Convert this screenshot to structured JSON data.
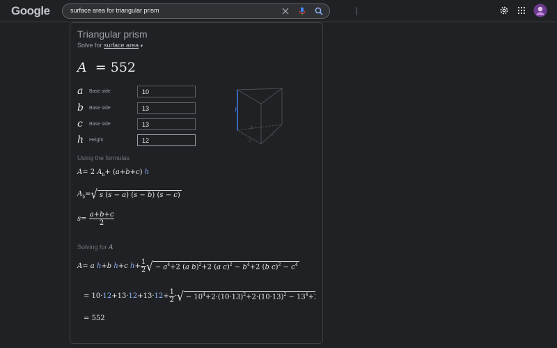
{
  "search": {
    "query": "surface area for triangular prism"
  },
  "logo": {
    "text": "Google"
  },
  "card": {
    "title": "Triangular prism",
    "solve_for_prefix": "Solve for",
    "solve_for_value": "surface area",
    "result": {
      "lhs": "A",
      "eq": "=",
      "value": "552"
    },
    "variables": [
      {
        "symbol": "a",
        "label": "Base side",
        "value": "10"
      },
      {
        "symbol": "b",
        "label": "Base side",
        "value": "13"
      },
      {
        "symbol": "c",
        "label": "Base side",
        "value": "13"
      },
      {
        "symbol": "h",
        "label": "Height",
        "value": "12"
      }
    ],
    "diagram_labels": {
      "h": "h",
      "a": "a",
      "b": "b",
      "c": "c"
    },
    "using_formulas_label": "Using the formulas",
    "solving_for_prefix": "Solving for",
    "solving_for_var": "A",
    "final_value": "552"
  },
  "colors": {
    "background": "#202124",
    "accent": "#8ab4f8",
    "input_border": "#5f6368"
  },
  "icons": [
    "clear-icon",
    "microphone-icon",
    "search-icon",
    "settings-icon",
    "apps-icon",
    "avatar"
  ]
}
